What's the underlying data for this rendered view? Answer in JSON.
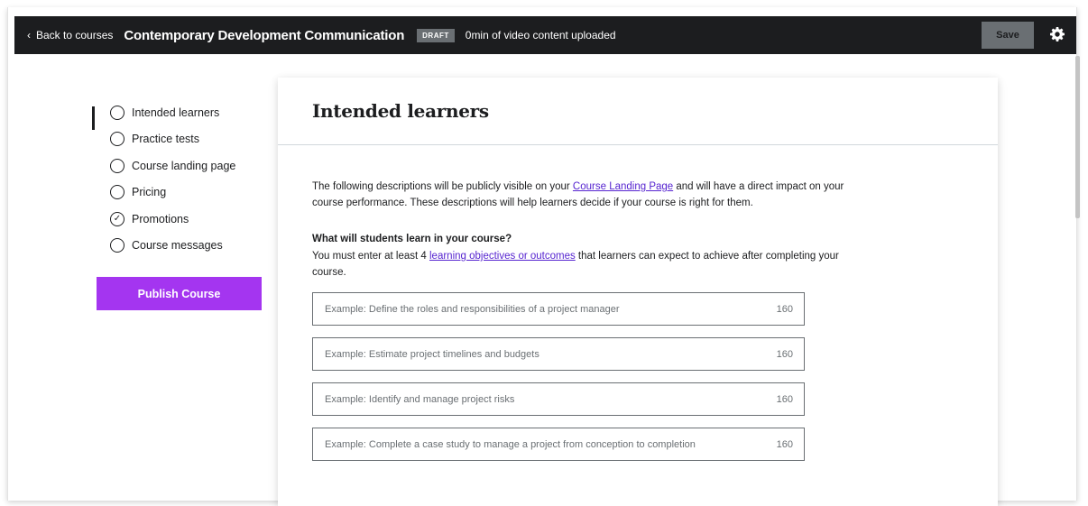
{
  "topbar": {
    "back_label": "Back to courses",
    "course_title": "Contemporary Development Communication",
    "status_badge": "DRAFT",
    "upload_status": "0min of video content uploaded",
    "save_label": "Save"
  },
  "sidebar": {
    "items": [
      {
        "label": "Intended learners",
        "state": "active"
      },
      {
        "label": "Practice tests",
        "state": "empty"
      },
      {
        "label": "Course landing page",
        "state": "empty"
      },
      {
        "label": "Pricing",
        "state": "empty"
      },
      {
        "label": "Promotions",
        "state": "completed"
      },
      {
        "label": "Course messages",
        "state": "empty"
      }
    ],
    "publish_label": "Publish Course"
  },
  "main": {
    "title": "Intended learners",
    "intro_before": "The following descriptions will be publicly visible on your ",
    "intro_link": "Course Landing Page",
    "intro_after": " and will have a direct impact on your course performance. These descriptions will help learners decide if your course is right for them.",
    "question_title": "What will students learn in your course?",
    "question_before": "You must enter at least 4 ",
    "question_link": "learning objectives or outcomes",
    "question_after": " that learners can expect to achieve after completing your course.",
    "objectives": [
      {
        "placeholder": "Example: Define the roles and responsibilities of a project manager",
        "counter": "160"
      },
      {
        "placeholder": "Example: Estimate project timelines and budgets",
        "counter": "160"
      },
      {
        "placeholder": "Example: Identify and manage project risks",
        "counter": "160"
      },
      {
        "placeholder": "Example: Complete a case study to manage a project from conception to completion",
        "counter": "160"
      }
    ]
  },
  "colors": {
    "accent": "#a435f0",
    "link": "#5624d0",
    "topbar": "#1c1d1f"
  },
  "icons": {
    "back": "chevron-left-icon",
    "settings": "gear-icon",
    "completed": "check-circle-icon"
  }
}
